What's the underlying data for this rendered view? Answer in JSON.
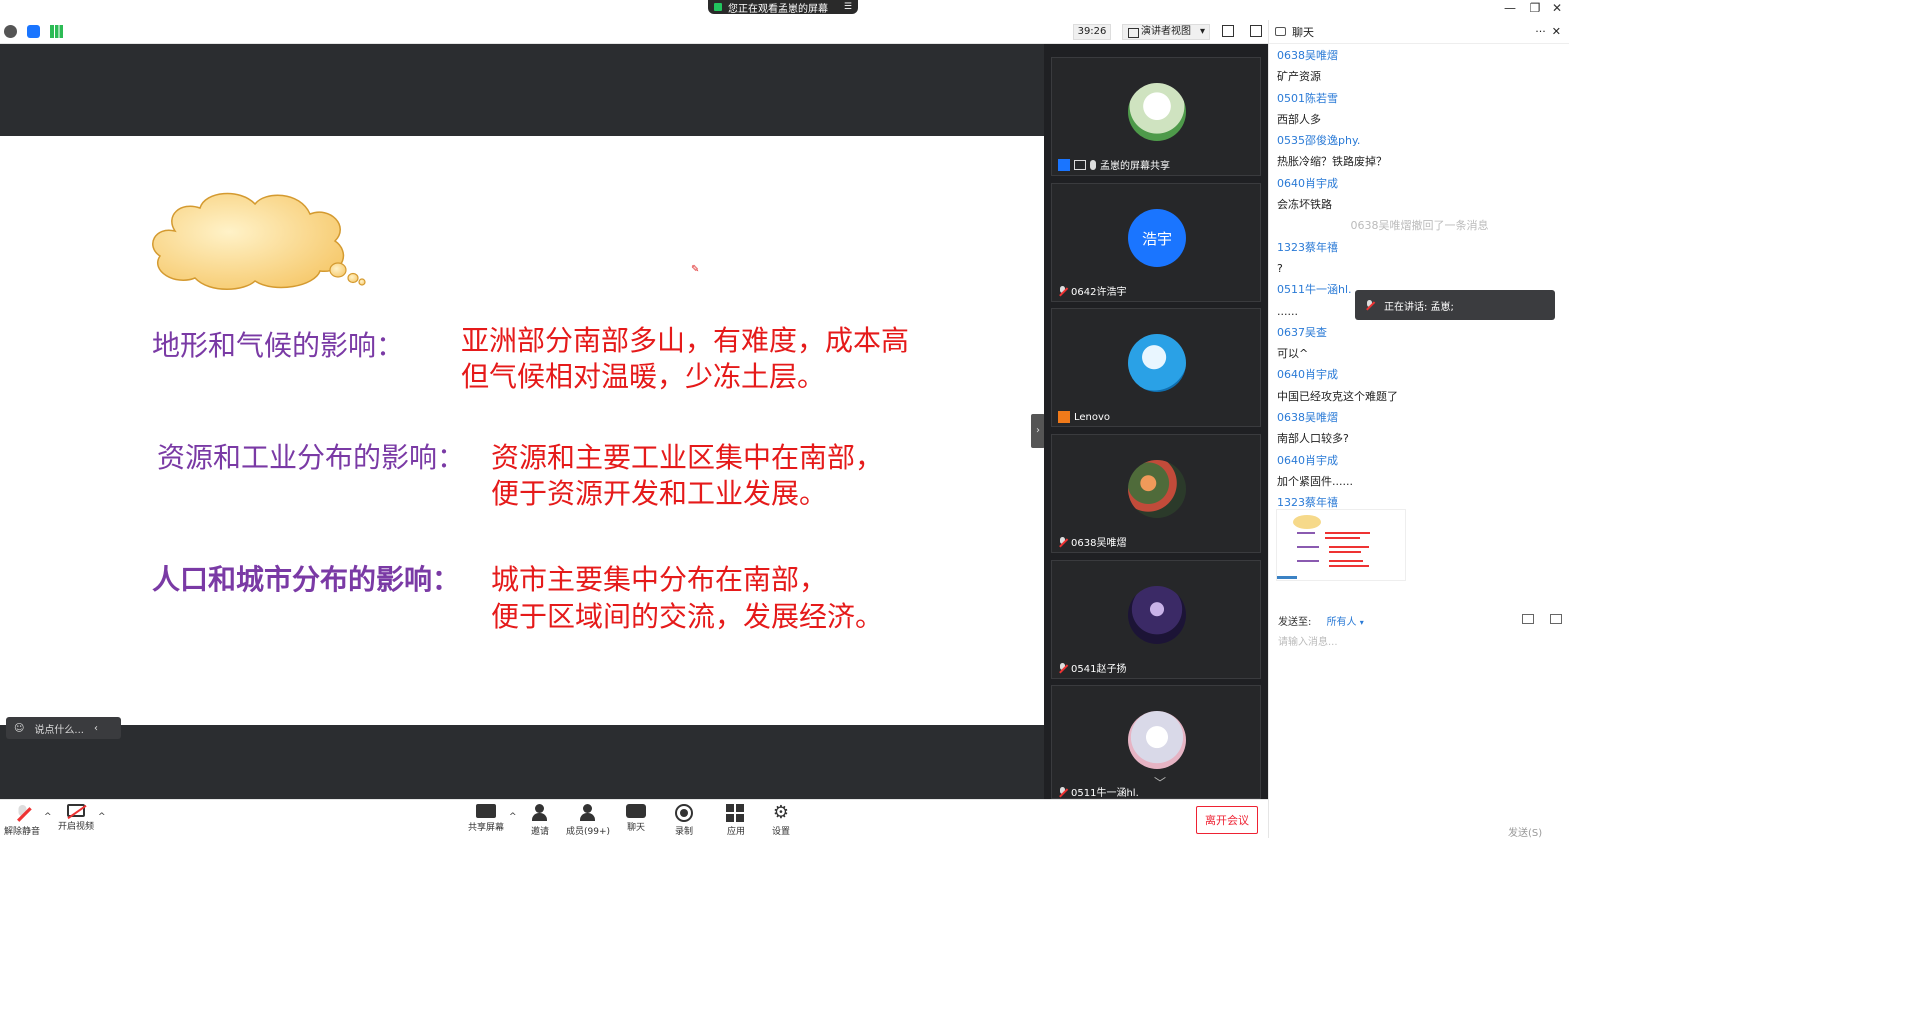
{
  "window": {
    "share_banner": "您正在观看孟崽的屏幕",
    "minimize": "—",
    "restore": "❐",
    "close": "✕"
  },
  "toolbar": {
    "timer": "39:26",
    "view_mode": "演讲者视图",
    "dropdown": "▾"
  },
  "slide": {
    "rows": [
      {
        "label": "地形和气候的影响：",
        "lines": [
          "亚洲部分南部多山，有难度，成本高",
          "但气候相对温暖，少冻土层。"
        ]
      },
      {
        "label": "资源和工业分布的影响：",
        "lines": [
          "资源和主要工业区集中在南部，",
          "便于资源开发和工业发展。"
        ]
      },
      {
        "label": "人口和城市分布的影响：",
        "lines": [
          "城市主要集中分布在南部，",
          "便于区域间的交流，发展经济。"
        ]
      }
    ],
    "say_placeholder": "说点什么...",
    "say_arrow": "‹"
  },
  "gallery": {
    "up_arrow": "︿",
    "down_arrow": "﹀",
    "handle": "›",
    "tiles": [
      {
        "name": "孟崽的屏幕共享",
        "avatar_color": "#cfe3c0"
      },
      {
        "name": "0642许浩宇",
        "avatar_text": "浩宇",
        "avatar_color": "#1a75ff"
      },
      {
        "name": "Lenovo",
        "avatar_color": "#2aa1e6"
      },
      {
        "name": "0638吴唯熠",
        "avatar_color": "#4f6b3a"
      },
      {
        "name": "0541赵子扬",
        "avatar_color": "#3b2a66"
      },
      {
        "name": "0511牛一涵hl.",
        "avatar_color": "#e9e9f2"
      }
    ]
  },
  "chat": {
    "title": "聊天",
    "more": "···",
    "close": "✕",
    "messages": [
      {
        "type": "sender",
        "text": "0638吴唯熠"
      },
      {
        "type": "text",
        "text": "矿产资源"
      },
      {
        "type": "sender",
        "text": "0501陈若雪"
      },
      {
        "type": "text",
        "text": "西部人多"
      },
      {
        "type": "sender",
        "text": "0535邵俊逸phy."
      },
      {
        "type": "text",
        "text": "热胀冷缩？铁路废掉？"
      },
      {
        "type": "sender",
        "text": "0640肖宇成"
      },
      {
        "type": "text",
        "text": "会冻坏铁路"
      },
      {
        "type": "system",
        "text": "0638吴唯熠撤回了一条消息"
      },
      {
        "type": "sender",
        "text": "1323蔡年禧"
      },
      {
        "type": "text",
        "text": "?"
      },
      {
        "type": "sender",
        "text": "0511牛一涵hl."
      },
      {
        "type": "text",
        "text": "......"
      },
      {
        "type": "sender",
        "text": "0637吴查"
      },
      {
        "type": "text",
        "text": "可以^"
      },
      {
        "type": "sender",
        "text": "0640肖宇成"
      },
      {
        "type": "text",
        "text": "中国已经攻克这个难题了"
      },
      {
        "type": "sender",
        "text": "0638吴唯熠"
      },
      {
        "type": "text",
        "text": "南部人口较多?"
      },
      {
        "type": "sender",
        "text": "0640肖宇成"
      },
      {
        "type": "text",
        "text": "加个紧固件......"
      },
      {
        "type": "sender",
        "text": "1323蔡年禧"
      }
    ],
    "speaking": "正在讲话: 孟崽;",
    "send_to_label": "发送至:",
    "send_to_value": "所有人",
    "input_placeholder": "请输入消息...",
    "send_button": "发送(S)"
  },
  "bottom": {
    "mute": "解除静音",
    "video": "开启视频",
    "share": "共享屏幕",
    "invite": "邀请",
    "members": "成员(99+)",
    "chat": "聊天",
    "record": "录制",
    "apps": "应用",
    "settings": "设置",
    "leave": "离开会议",
    "caret": "^"
  },
  "colors": {
    "accent": "#2a7ad6",
    "slide_purple": "#7a3aa5",
    "slide_red": "#e51a1a",
    "leave_red": "#e22233"
  }
}
